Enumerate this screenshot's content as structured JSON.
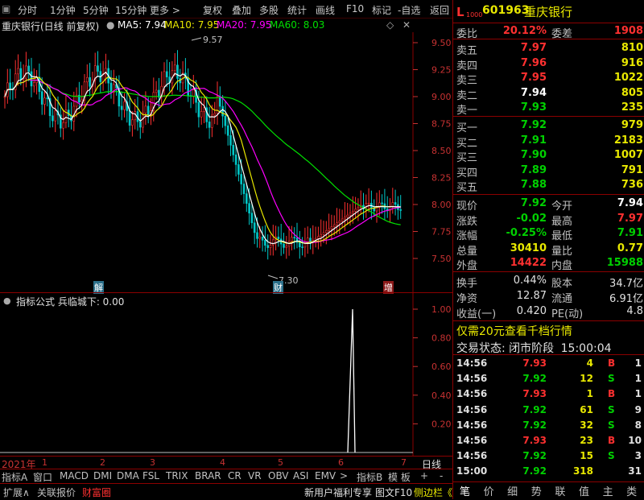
{
  "toolbar": {
    "items": [
      "分时",
      "1分钟",
      "5分钟",
      "15分钟",
      "更多 >",
      "复权",
      "叠加",
      "多股",
      "统计",
      "画线",
      "F10",
      "标记",
      "-自选",
      "返回"
    ]
  },
  "chart": {
    "title": "重庆银行(日线 前复权)",
    "ma": [
      {
        "label": "MA5: 7.94",
        "color": "#ffffff"
      },
      {
        "label": "MA10: 7.95",
        "color": "#e8e800"
      },
      {
        "label": "MA20: 7.95",
        "color": "#ff00ff"
      },
      {
        "label": "MA60: 8.03",
        "color": "#00e000"
      }
    ],
    "y_ticks": [
      "9.50",
      "9.25",
      "9.00",
      "8.75",
      "8.50",
      "8.25",
      "8.00",
      "7.75",
      "7.50"
    ],
    "high_label": "9.57",
    "low_label": "7.30",
    "markers": [
      "解",
      "财",
      "增"
    ]
  },
  "indicator": {
    "title": "指标公式  兵临城下: 0.00",
    "y_ticks": [
      "1.00",
      "0.80",
      "0.60",
      "0.40",
      "0.20"
    ]
  },
  "time_axis": {
    "year": "2021年",
    "months": [
      "1",
      "2",
      "3",
      "4",
      "5",
      "6",
      "7"
    ],
    "period": "日线"
  },
  "bottom_tabs": [
    "指标A",
    "窗口",
    "MACD",
    "DMI",
    "DMA",
    "FSL",
    "TRIX",
    "BRAR",
    "CR",
    "VR",
    "OBV",
    "ASI",
    "EMV",
    ">",
    "指标B",
    "模 板",
    "+",
    "-"
  ],
  "status_bar": [
    "扩展∧",
    "关联报价",
    "财富圈",
    "新用户福利专享",
    "图文F10",
    "侧边栏《"
  ],
  "quote": {
    "code": "601963",
    "name": "重庆银行",
    "weibi_label": "委比",
    "weibi": "20.12%",
    "weicha_label": "委差",
    "weicha": "1908",
    "asks": [
      {
        "label": "卖五",
        "price": "7.97",
        "vol": "810"
      },
      {
        "label": "卖四",
        "price": "7.96",
        "vol": "916"
      },
      {
        "label": "卖三",
        "price": "7.95",
        "vol": "1022"
      },
      {
        "label": "卖二",
        "price": "7.94",
        "vol": "805"
      },
      {
        "label": "卖一",
        "price": "7.93",
        "vol": "235"
      }
    ],
    "bids": [
      {
        "label": "买一",
        "price": "7.92",
        "vol": "979"
      },
      {
        "label": "买二",
        "price": "7.91",
        "vol": "2183"
      },
      {
        "label": "买三",
        "price": "7.90",
        "vol": "1007"
      },
      {
        "label": "买四",
        "price": "7.89",
        "vol": "791"
      },
      {
        "label": "买五",
        "price": "7.88",
        "vol": "736"
      }
    ],
    "stats": [
      {
        "l1": "现价",
        "v1": "7.92",
        "c1": "#00d000",
        "l2": "今开",
        "v2": "7.94",
        "c2": "#ffffff"
      },
      {
        "l1": "涨跌",
        "v1": "-0.02",
        "c1": "#00d000",
        "l2": "最高",
        "v2": "7.97",
        "c2": "#ff3030"
      },
      {
        "l1": "涨幅",
        "v1": "-0.25%",
        "c1": "#00d000",
        "l2": "最低",
        "v2": "7.91",
        "c2": "#00d000"
      },
      {
        "l1": "总量",
        "v1": "30410",
        "c1": "#e8e800",
        "l2": "量比",
        "v2": "0.77",
        "c2": "#e8e800"
      },
      {
        "l1": "外盘",
        "v1": "14422",
        "c1": "#ff3030",
        "l2": "内盘",
        "v2": "15988",
        "c2": "#00d000"
      }
    ],
    "fundamentals": [
      {
        "l1": "换手",
        "v1": "0.44%",
        "l2": "股本",
        "v2": "34.7亿"
      },
      {
        "l1": "净资",
        "v1": "12.87",
        "l2": "流通",
        "v2": "6.91亿"
      },
      {
        "l1": "收益(一)",
        "v1": "0.420",
        "l2": "PE(动)",
        "v2": "4.8"
      }
    ],
    "promo": "仅需20元查看千档行情",
    "trade_state_label": "交易状态: 闭市阶段",
    "trade_state_time": "15:00:04"
  },
  "ticks": [
    {
      "time": "14:56",
      "price": "7.93",
      "vol": "4",
      "side": "B",
      "n": "1"
    },
    {
      "time": "14:56",
      "price": "7.92",
      "vol": "12",
      "side": "S",
      "n": "1"
    },
    {
      "time": "14:56",
      "price": "7.93",
      "vol": "1",
      "side": "B",
      "n": "1"
    },
    {
      "time": "14:56",
      "price": "7.92",
      "vol": "61",
      "side": "S",
      "n": "9"
    },
    {
      "time": "14:56",
      "price": "7.92",
      "vol": "32",
      "side": "S",
      "n": "8"
    },
    {
      "time": "14:56",
      "price": "7.93",
      "vol": "23",
      "side": "B",
      "n": "10"
    },
    {
      "time": "14:56",
      "price": "7.92",
      "vol": "15",
      "side": "S",
      "n": "3"
    },
    {
      "time": "15:00",
      "price": "7.92",
      "vol": "318",
      "side": "",
      "n": "31"
    }
  ],
  "nav_tabs": [
    "笔",
    "价",
    "细",
    "势",
    "联",
    "值",
    "主",
    "类"
  ]
}
